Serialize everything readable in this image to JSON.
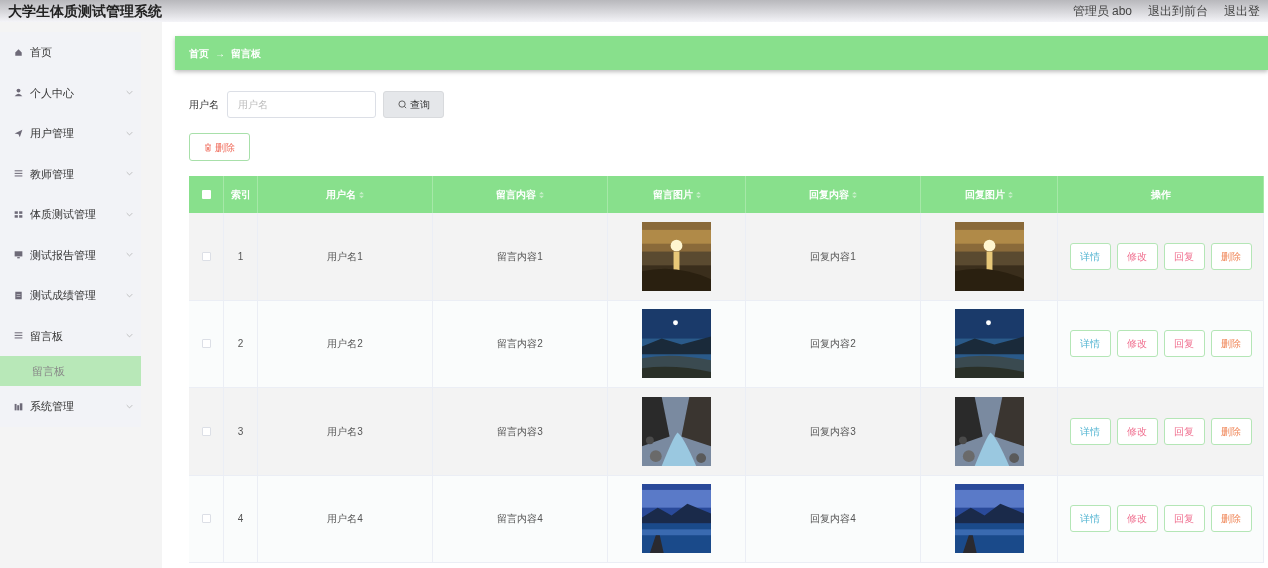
{
  "header": {
    "title": "大学生体质测试管理系统",
    "links": [
      {
        "label": "管理员 abo"
      },
      {
        "label": "退出到前台"
      },
      {
        "label": "退出登"
      }
    ]
  },
  "sidebar": {
    "items": [
      {
        "label": "首页",
        "kind": "link"
      },
      {
        "label": "个人中心",
        "kind": "group"
      },
      {
        "label": "用户管理",
        "kind": "group"
      },
      {
        "label": "教师管理",
        "kind": "group"
      },
      {
        "label": "体质测试管理",
        "kind": "group"
      },
      {
        "label": "测试报告管理",
        "kind": "group"
      },
      {
        "label": "测试成绩管理",
        "kind": "group"
      },
      {
        "label": "留言板",
        "kind": "group",
        "children": [
          {
            "label": "留言板",
            "selected": true
          }
        ]
      },
      {
        "label": "系统管理",
        "kind": "group"
      }
    ]
  },
  "breadcrumb": [
    "首页",
    "→",
    "留言板"
  ],
  "search": {
    "label": "用户名",
    "placeholder": "用户名",
    "button": "查询"
  },
  "delete_button": "删除",
  "table": {
    "columns": [
      {
        "kind": "checkbox"
      },
      {
        "label": "索引",
        "kind": "text"
      },
      {
        "label": "用户名",
        "kind": "sortable"
      },
      {
        "label": "留言内容",
        "kind": "sortable"
      },
      {
        "label": "留言图片",
        "kind": "sortable"
      },
      {
        "label": "回复内容",
        "kind": "sortable"
      },
      {
        "label": "回复图片",
        "kind": "sortable"
      },
      {
        "label": "操作",
        "kind": "text"
      }
    ],
    "header_checked": false,
    "rows": [
      {
        "checked": false,
        "index": "1",
        "username": "用户名1",
        "message": "留言内容1",
        "reply": "回复内容1",
        "actions": [
          "详情",
          "修改",
          "回复",
          "删除"
        ]
      },
      {
        "checked": false,
        "index": "2",
        "username": "用户名2",
        "message": "留言内容2",
        "reply": "回复内容2",
        "actions": [
          "详情",
          "修改",
          "回复",
          "删除"
        ]
      },
      {
        "checked": false,
        "index": "3",
        "username": "用户名3",
        "message": "留言内容3",
        "reply": "回复内容3",
        "actions": [
          "详情",
          "修改",
          "回复",
          "删除"
        ]
      },
      {
        "checked": false,
        "index": "4",
        "username": "用户名4",
        "message": "留言内容4",
        "reply": "回复内容4",
        "actions": [
          "详情",
          "修改",
          "回复",
          "删除"
        ]
      }
    ]
  }
}
